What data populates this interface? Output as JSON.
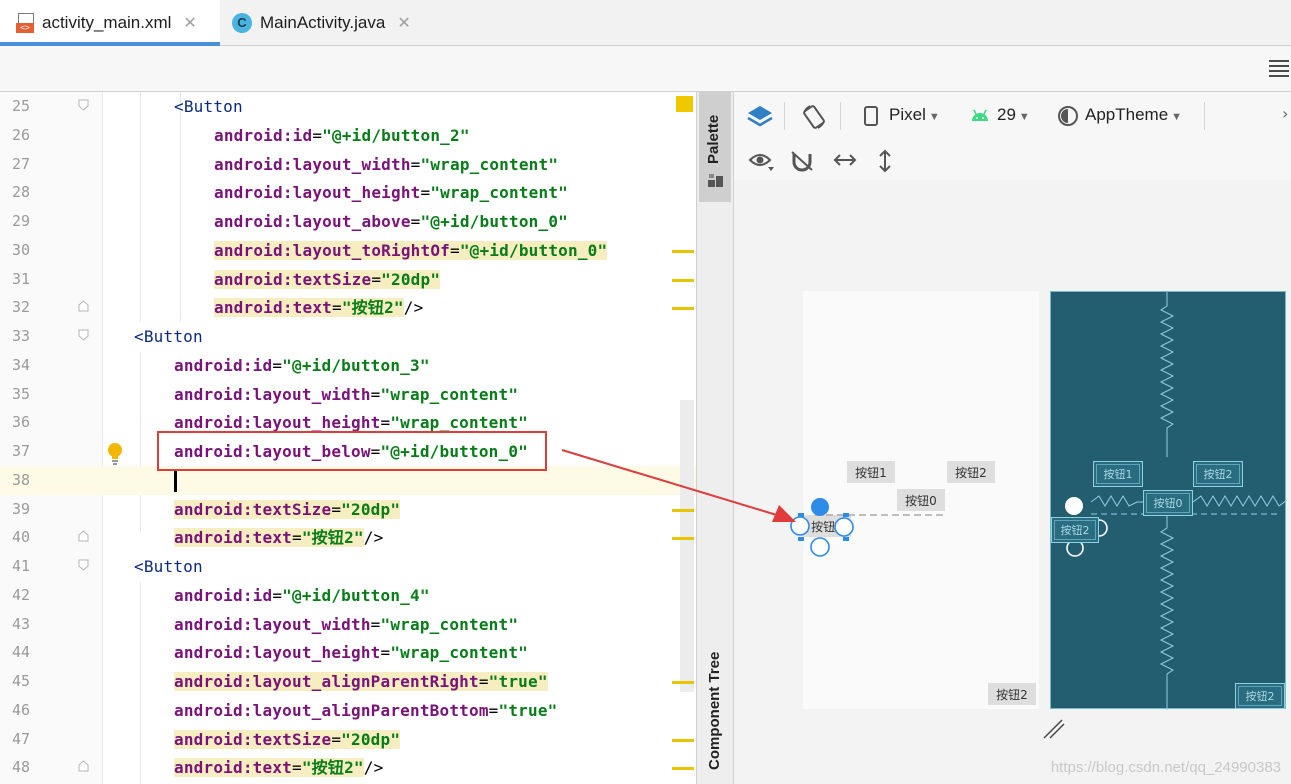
{
  "tabs": [
    {
      "label": "activity_main.xml",
      "icon": "xml-file-icon",
      "active": true
    },
    {
      "label": "MainActivity.java",
      "icon": "java-class-icon",
      "active": false
    }
  ],
  "editor": {
    "lines": [
      {
        "n": "25",
        "indent": 174,
        "fold": "open",
        "tokens": [
          {
            "t": "tag",
            "v": "<Button"
          }
        ]
      },
      {
        "n": "26",
        "indent": 214,
        "tokens": [
          {
            "t": "attr",
            "v": "android:id"
          },
          {
            "t": "eq",
            "v": "="
          },
          {
            "t": "val",
            "v": "\"@+id/button_2\""
          }
        ]
      },
      {
        "n": "27",
        "indent": 214,
        "tokens": [
          {
            "t": "attr",
            "v": "android:layout_width"
          },
          {
            "t": "eq",
            "v": "="
          },
          {
            "t": "val",
            "v": "\"wrap_content\""
          }
        ]
      },
      {
        "n": "28",
        "indent": 214,
        "tokens": [
          {
            "t": "attr",
            "v": "android:layout_height"
          },
          {
            "t": "eq",
            "v": "="
          },
          {
            "t": "val",
            "v": "\"wrap_content\""
          }
        ]
      },
      {
        "n": "29",
        "indent": 214,
        "tokens": [
          {
            "t": "attr",
            "v": "android:layout_above"
          },
          {
            "t": "eq",
            "v": "="
          },
          {
            "t": "val",
            "v": "\"@+id/button_0\""
          }
        ]
      },
      {
        "n": "30",
        "indent": 214,
        "hl": true,
        "tokens": [
          {
            "t": "attr",
            "v": "android:layout_toRightOf"
          },
          {
            "t": "eq",
            "v": "="
          },
          {
            "t": "val",
            "v": "\"@+id/button_0\""
          }
        ]
      },
      {
        "n": "31",
        "indent": 214,
        "hl": true,
        "tokens": [
          {
            "t": "attr",
            "v": "android:textSize"
          },
          {
            "t": "eq",
            "v": "="
          },
          {
            "t": "val",
            "v": "\"20dp\""
          }
        ]
      },
      {
        "n": "32",
        "indent": 214,
        "hl": true,
        "fold": "close",
        "tokens": [
          {
            "t": "attr",
            "v": "android:text"
          },
          {
            "t": "eq",
            "v": "="
          },
          {
            "t": "val",
            "v": "\"按钮2\""
          },
          {
            "t": "plain",
            "v": "/>"
          }
        ]
      },
      {
        "n": "33",
        "indent": 134,
        "fold": "open",
        "tokens": [
          {
            "t": "tag",
            "v": "<Button"
          }
        ]
      },
      {
        "n": "34",
        "indent": 174,
        "tokens": [
          {
            "t": "attr",
            "v": "android:id"
          },
          {
            "t": "eq",
            "v": "="
          },
          {
            "t": "val",
            "v": "\"@+id/button_3\""
          }
        ]
      },
      {
        "n": "35",
        "indent": 174,
        "tokens": [
          {
            "t": "attr",
            "v": "android:layout_width"
          },
          {
            "t": "eq",
            "v": "="
          },
          {
            "t": "val",
            "v": "\"wrap_content\""
          }
        ]
      },
      {
        "n": "36",
        "indent": 174,
        "tokens": [
          {
            "t": "attr",
            "v": "android:layout_height"
          },
          {
            "t": "eq",
            "v": "="
          },
          {
            "t": "val",
            "v": "\"wrap_content\""
          }
        ]
      },
      {
        "n": "37",
        "indent": 174,
        "bulb": true,
        "tokens": [
          {
            "t": "attr",
            "v": "android:layout_below"
          },
          {
            "t": "eq",
            "v": "="
          },
          {
            "t": "val",
            "v": "\"@+id/button_0\""
          }
        ]
      },
      {
        "n": "38",
        "indent": 174,
        "current": true,
        "tokens": []
      },
      {
        "n": "39",
        "indent": 174,
        "hl": true,
        "tokens": [
          {
            "t": "attr",
            "v": "android:textSize"
          },
          {
            "t": "eq",
            "v": "="
          },
          {
            "t": "val",
            "v": "\"20dp\""
          }
        ]
      },
      {
        "n": "40",
        "indent": 174,
        "hl": true,
        "fold": "close",
        "tokens": [
          {
            "t": "attr",
            "v": "android:text"
          },
          {
            "t": "eq",
            "v": "="
          },
          {
            "t": "val",
            "v": "\"按钮2\""
          },
          {
            "t": "plain",
            "v": "/>"
          }
        ]
      },
      {
        "n": "41",
        "indent": 134,
        "fold": "open",
        "tokens": [
          {
            "t": "tag",
            "v": "<Button"
          }
        ]
      },
      {
        "n": "42",
        "indent": 174,
        "tokens": [
          {
            "t": "attr",
            "v": "android:id"
          },
          {
            "t": "eq",
            "v": "="
          },
          {
            "t": "val",
            "v": "\"@+id/button_4\""
          }
        ]
      },
      {
        "n": "43",
        "indent": 174,
        "tokens": [
          {
            "t": "attr",
            "v": "android:layout_width"
          },
          {
            "t": "eq",
            "v": "="
          },
          {
            "t": "val",
            "v": "\"wrap_content\""
          }
        ]
      },
      {
        "n": "44",
        "indent": 174,
        "tokens": [
          {
            "t": "attr",
            "v": "android:layout_height"
          },
          {
            "t": "eq",
            "v": "="
          },
          {
            "t": "val",
            "v": "\"wrap_content\""
          }
        ]
      },
      {
        "n": "45",
        "indent": 174,
        "hl": true,
        "tokens": [
          {
            "t": "attr",
            "v": "android:layout_alignParentRight"
          },
          {
            "t": "eq",
            "v": "="
          },
          {
            "t": "val",
            "v": "\"true\""
          }
        ]
      },
      {
        "n": "46",
        "indent": 174,
        "tokens": [
          {
            "t": "attr",
            "v": "android:layout_alignParentBottom"
          },
          {
            "t": "eq",
            "v": "="
          },
          {
            "t": "val",
            "v": "\"true\""
          }
        ]
      },
      {
        "n": "47",
        "indent": 174,
        "hl": true,
        "tokens": [
          {
            "t": "attr",
            "v": "android:textSize"
          },
          {
            "t": "eq",
            "v": "="
          },
          {
            "t": "val",
            "v": "\"20dp\""
          }
        ]
      },
      {
        "n": "48",
        "indent": 174,
        "hl": true,
        "fold": "close",
        "tokens": [
          {
            "t": "attr",
            "v": "android:text"
          },
          {
            "t": "eq",
            "v": "="
          },
          {
            "t": "val",
            "v": "\"按钮2\""
          },
          {
            "t": "plain",
            "v": "/>"
          }
        ]
      }
    ]
  },
  "side_panels": {
    "palette": "Palette",
    "component_tree": "Component Tree"
  },
  "designer_toolbar": {
    "device": "Pixel",
    "api": "29",
    "theme": "AppTheme"
  },
  "preview": {
    "button1": "按钮1",
    "button2_top": "按钮2",
    "button0": "按钮0",
    "button3": "按钮2",
    "button4": "按钮2"
  },
  "blueprint": {
    "button1": "按钮1",
    "button2_top": "按钮2",
    "button0": "按钮0",
    "button3": "按钮2",
    "button4": "按钮2"
  },
  "watermark": "https://blog.csdn.net/qq_24990383",
  "colors": {
    "tag": "#0a2a80",
    "attr": "#7a127a",
    "value": "#067d17",
    "highlight": "#f6edc0",
    "annotation_red": "#e03c3c",
    "blueprint_bg": "#235d70"
  }
}
